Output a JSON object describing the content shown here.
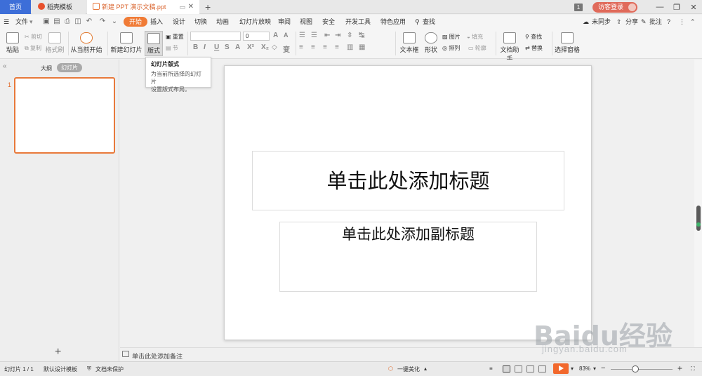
{
  "tabs": {
    "home": "首页",
    "docer": "稻壳模板",
    "document": "新建 PPT 演示文稿.ppt",
    "add": "+"
  },
  "window": {
    "badge": "1",
    "login": "访客登录"
  },
  "menu": {
    "file": "文件",
    "items": [
      "开始",
      "插入",
      "设计",
      "切换",
      "动画",
      "幻灯片放映",
      "审阅",
      "视图",
      "安全",
      "开发工具",
      "特色应用"
    ],
    "search": "查找",
    "sync": "未同步",
    "share": "分享",
    "annotate": "批注"
  },
  "ribbon": {
    "paste": "粘贴",
    "cut": "剪切",
    "copy": "复制",
    "format_painter": "格式刷",
    "from_current": "从当前开始",
    "new_slide": "新建幻灯片",
    "layout": "版式",
    "reset": "重置",
    "section": "节",
    "font_size": "0",
    "text_box": "文本框",
    "shape": "形状",
    "picture": "图片",
    "fill": "填充",
    "arrange": "排列",
    "outline": "轮廓",
    "doc_assistant": "文档助手",
    "find": "查找",
    "replace": "替换",
    "select_pane": "选择窗格"
  },
  "tooltip": {
    "title": "幻灯片版式",
    "line1": "为当前所选择的幻灯片",
    "line2": "设置版式布局。"
  },
  "leftpanel": {
    "outline": "大纲",
    "slides": "幻灯片",
    "slide_number": "1"
  },
  "slide": {
    "title": "单击此处添加标题",
    "subtitle": "单击此处添加副标题"
  },
  "notes": {
    "placeholder": "单击此处添加备注"
  },
  "status": {
    "slide_count": "幻灯片 1 / 1",
    "template": "默认设计模板",
    "protection": "文档未保护",
    "beautify": "一键美化",
    "zoom": "83%",
    "zoom_minus": "−",
    "zoom_plus": "+"
  },
  "watermark": {
    "brand": "Baidu经验",
    "url": "jingyan.baidu.com"
  },
  "colors": {
    "accent": "#f07b36",
    "tab_home": "#3d6ed8",
    "login": "#e06a5a"
  }
}
